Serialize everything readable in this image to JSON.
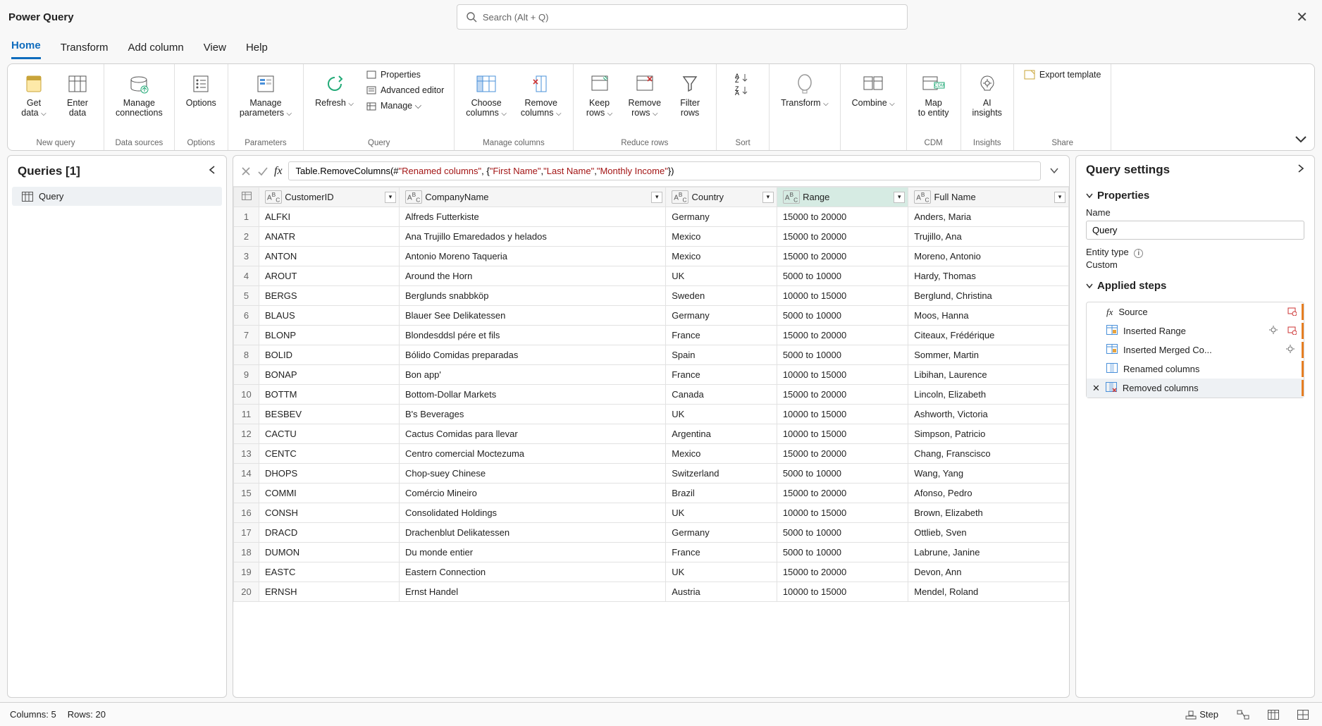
{
  "app": {
    "title": "Power Query"
  },
  "search": {
    "placeholder": "Search (Alt + Q)"
  },
  "menutabs": [
    "Home",
    "Transform",
    "Add column",
    "View",
    "Help"
  ],
  "ribbon": {
    "groups": [
      {
        "label": "New query",
        "buttons": [
          {
            "label": "Get data",
            "chev": true
          },
          {
            "label": "Enter data"
          }
        ]
      },
      {
        "label": "Data sources",
        "buttons": [
          {
            "label": "Manage connections"
          }
        ]
      },
      {
        "label": "Options",
        "buttons": [
          {
            "label": "Options"
          }
        ]
      },
      {
        "label": "Parameters",
        "buttons": [
          {
            "label": "Manage parameters",
            "chev": true
          }
        ]
      },
      {
        "label": "Query",
        "buttons": [
          {
            "label": "Refresh",
            "chev": true
          }
        ],
        "smalls": [
          "Properties",
          "Advanced editor",
          "Manage"
        ]
      },
      {
        "label": "Manage columns",
        "buttons": [
          {
            "label": "Choose columns",
            "chev": true
          },
          {
            "label": "Remove columns",
            "chev": true
          }
        ]
      },
      {
        "label": "Reduce rows",
        "buttons": [
          {
            "label": "Keep rows",
            "chev": true
          },
          {
            "label": "Remove rows",
            "chev": true
          },
          {
            "label": "Filter rows"
          }
        ]
      },
      {
        "label": "Sort",
        "buttons": []
      },
      {
        "label": "",
        "buttons": [
          {
            "label": "Transform",
            "chev": true
          }
        ]
      },
      {
        "label": "",
        "buttons": [
          {
            "label": "Combine",
            "chev": true
          }
        ]
      },
      {
        "label": "CDM",
        "buttons": [
          {
            "label": "Map to entity"
          }
        ]
      },
      {
        "label": "Insights",
        "buttons": [
          {
            "label": "AI insights"
          }
        ]
      },
      {
        "label": "Share",
        "buttons": [],
        "smalls_top": [
          "Export template"
        ]
      }
    ]
  },
  "queries": {
    "header": "Queries [1]",
    "items": [
      "Query"
    ]
  },
  "formula": {
    "prefix": "Table.RemoveColumns(#",
    "arg1": "\"Renamed columns\"",
    "mid": ", {",
    "s1": "\"First Name\"",
    "s2": "\"Last Name\"",
    "s3": "\"Monthly Income\"",
    "suffix": "})"
  },
  "table": {
    "columns": [
      "CustomerID",
      "CompanyName",
      "Country",
      "Range",
      "Full Name"
    ],
    "highlighted_col": 3,
    "rows": [
      [
        "ALFKI",
        "Alfreds Futterkiste",
        "Germany",
        "15000 to 20000",
        "Anders, Maria"
      ],
      [
        "ANATR",
        "Ana Trujillo Emaredados y helados",
        "Mexico",
        "15000 to 20000",
        "Trujillo, Ana"
      ],
      [
        "ANTON",
        "Antonio Moreno Taqueria",
        "Mexico",
        "15000 to 20000",
        "Moreno, Antonio"
      ],
      [
        "AROUT",
        "Around the Horn",
        "UK",
        "5000 to 10000",
        "Hardy, Thomas"
      ],
      [
        "BERGS",
        "Berglunds snabbköp",
        "Sweden",
        "10000 to 15000",
        "Berglund, Christina"
      ],
      [
        "BLAUS",
        "Blauer See Delikatessen",
        "Germany",
        "5000 to 10000",
        "Moos, Hanna"
      ],
      [
        "BLONP",
        "Blondesddsl pére et fils",
        "France",
        "15000 to 20000",
        "Citeaux, Frédérique"
      ],
      [
        "BOLID",
        "Bólido Comidas preparadas",
        "Spain",
        "5000 to 10000",
        "Sommer, Martin"
      ],
      [
        "BONAP",
        "Bon app'",
        "France",
        "10000 to 15000",
        "Libihan, Laurence"
      ],
      [
        "BOTTM",
        "Bottom-Dollar Markets",
        "Canada",
        "15000 to 20000",
        "Lincoln, Elizabeth"
      ],
      [
        "BESBEV",
        "B's Beverages",
        "UK",
        "10000 to 15000",
        "Ashworth, Victoria"
      ],
      [
        "CACTU",
        "Cactus Comidas para llevar",
        "Argentina",
        "10000 to 15000",
        "Simpson, Patricio"
      ],
      [
        "CENTC",
        "Centro comercial Moctezuma",
        "Mexico",
        "15000 to 20000",
        "Chang, Franscisco"
      ],
      [
        "DHOPS",
        "Chop-suey Chinese",
        "Switzerland",
        "5000 to 10000",
        "Wang, Yang"
      ],
      [
        "COMMI",
        "Comércio Mineiro",
        "Brazil",
        "15000 to 20000",
        "Afonso, Pedro"
      ],
      [
        "CONSH",
        "Consolidated Holdings",
        "UK",
        "10000 to 15000",
        "Brown, Elizabeth"
      ],
      [
        "DRACD",
        "Drachenblut Delikatessen",
        "Germany",
        "5000 to 10000",
        "Ottlieb, Sven"
      ],
      [
        "DUMON",
        "Du monde entier",
        "France",
        "5000 to 10000",
        "Labrune, Janine"
      ],
      [
        "EASTC",
        "Eastern Connection",
        "UK",
        "15000 to 20000",
        "Devon, Ann"
      ],
      [
        "ERNSH",
        "Ernst Handel",
        "Austria",
        "10000 to 15000",
        "Mendel, Roland"
      ]
    ]
  },
  "settings": {
    "title": "Query settings",
    "properties_label": "Properties",
    "name_label": "Name",
    "name_value": "Query",
    "entity_label": "Entity type",
    "entity_value": "Custom",
    "steps_label": "Applied steps",
    "steps": [
      {
        "label": "Source",
        "icon": "fx",
        "gear": false,
        "extra": true
      },
      {
        "label": "Inserted Range",
        "icon": "table",
        "gear": true,
        "extra": true
      },
      {
        "label": "Inserted Merged Co...",
        "icon": "table",
        "gear": true
      },
      {
        "label": "Renamed columns",
        "icon": "cols"
      },
      {
        "label": "Removed columns",
        "icon": "colsx",
        "active": true,
        "delete": true
      }
    ]
  },
  "status": {
    "cols": "Columns: 5",
    "rows": "Rows: 20",
    "step": "Step"
  }
}
